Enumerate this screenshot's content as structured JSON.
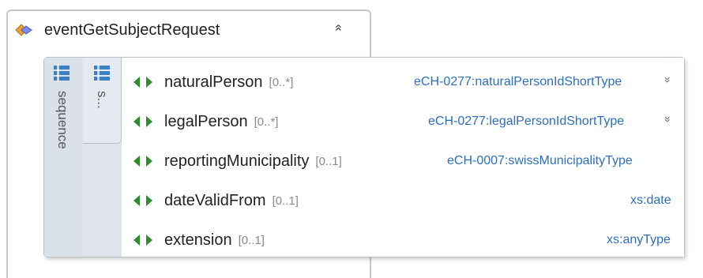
{
  "element": {
    "name": "eventGetSubjectRequest",
    "collapse_glyph": "»"
  },
  "sequence": {
    "label": "sequence",
    "inner_label": "s..."
  },
  "children": [
    {
      "name": "naturalPerson",
      "cardinality": "[0..*]",
      "type": "eCH-0277:naturalPersonIdShortType",
      "expandable": true
    },
    {
      "name": "legalPerson",
      "cardinality": "[0..*]",
      "type": "eCH-0277:legalPersonIdShortType",
      "expandable": true
    },
    {
      "name": "reportingMunicipality",
      "cardinality": "[0..1]",
      "type": "eCH-0007:swissMunicipalityType",
      "expandable": false
    },
    {
      "name": "dateValidFrom",
      "cardinality": "[0..1]",
      "type": "xs:date",
      "expandable": false
    },
    {
      "name": "extension",
      "cardinality": "[0..1]",
      "type": "xs:anyType",
      "expandable": false
    }
  ],
  "expand_glyph": "»",
  "colors": {
    "element_arrow": "#2e8b2e",
    "type_text": "#2f6eb5",
    "sequence_bg": "#dfe4ec"
  }
}
